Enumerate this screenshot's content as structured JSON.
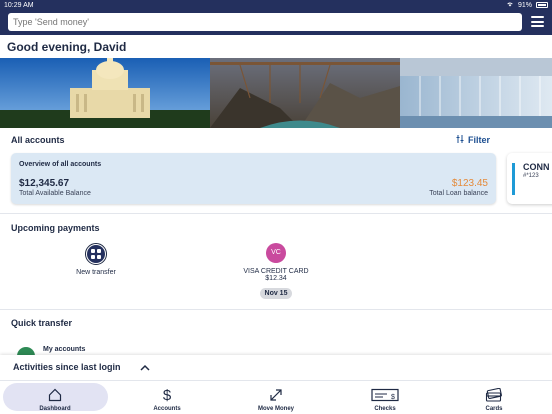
{
  "status_bar": {
    "time": "10:29 AM",
    "battery": "91%"
  },
  "header": {
    "search_placeholder": "Type 'Send money'"
  },
  "greeting": "Good evening, David",
  "accounts": {
    "title": "All accounts",
    "filter_label": "Filter",
    "overview": {
      "title": "Overview of all accounts",
      "available_balance": "$12,345.67",
      "available_label": "Total Available Balance",
      "loan_balance": "$123.45",
      "loan_label": "Total Loan balance"
    },
    "next_card": {
      "name": "CONN",
      "number": "#*123"
    }
  },
  "upcoming_payments": {
    "title": "Upcoming payments",
    "new_transfer_label": "New transfer",
    "payment": {
      "initials": "VC",
      "name": "VISA CREDIT CARD",
      "amount": "$12.34",
      "date": "Nov 15"
    }
  },
  "quick_transfer": {
    "title": "Quick transfer",
    "my_accounts_label": "My accounts"
  },
  "activities": {
    "title": "Activities since last login"
  },
  "tabs": [
    {
      "label": "Dashboard",
      "icon": "home-icon"
    },
    {
      "label": "Accounts",
      "icon": "dollar-icon"
    },
    {
      "label": "Move Money",
      "icon": "transfer-arrows-icon"
    },
    {
      "label": "Checks",
      "icon": "check-icon"
    },
    {
      "label": "Cards",
      "icon": "cards-icon"
    }
  ],
  "colors": {
    "header": "#24305e",
    "loan": "#e48a3a",
    "accent": "#1d4f91",
    "overview_bg": "#dbe8f4",
    "vc_badge": "#c94a9e"
  }
}
